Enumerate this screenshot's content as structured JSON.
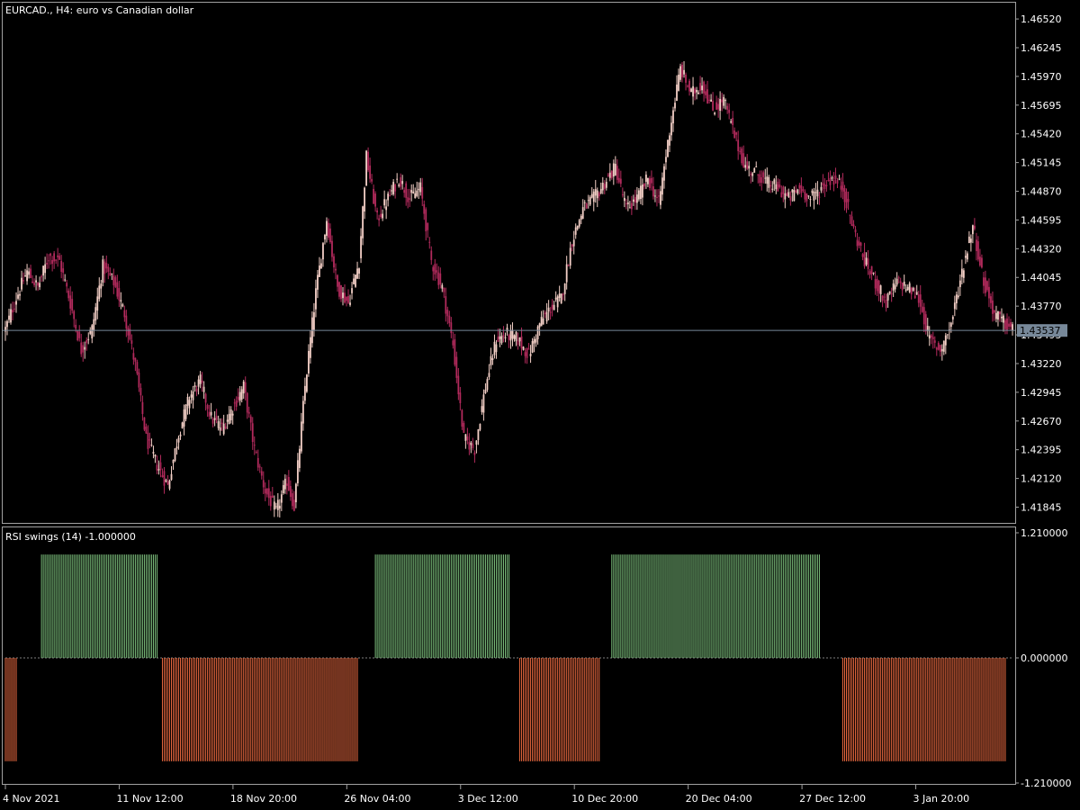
{
  "colors": {
    "background": "#000000",
    "frame": "#a0a0a0",
    "text": "#ffffff",
    "bull_candle": "#f3cfc6",
    "bear_candle": "#b22a5c",
    "current_price_line": "#778899",
    "price_tag_bg": "#778899",
    "rsi_up": "#7ec27e",
    "rsi_down": "#e8683f",
    "zero_line": "#808080"
  },
  "main_chart": {
    "title": "EURCAD., H4:  euro vs Canadian dollar",
    "current_price": "1.43537",
    "current_price_value": 1.43537,
    "y_min": 1.4172,
    "y_max": 1.4665,
    "y_ticks": [
      "1.46520",
      "1.46245",
      "1.45970",
      "1.45695",
      "1.45420",
      "1.45145",
      "1.44870",
      "1.44595",
      "1.44320",
      "1.44045",
      "1.43770",
      "1.43495",
      "1.43220",
      "1.42945",
      "1.42670",
      "1.42395",
      "1.42120",
      "1.41845"
    ]
  },
  "indicator": {
    "title": "RSI swings (14) -1.000000",
    "y_ticks": [
      "1.210000",
      "0.000000",
      "-1.210000"
    ],
    "y_min": -1.21,
    "y_max": 1.21
  },
  "x_axis": {
    "labels": [
      "4 Nov 2021",
      "11 Nov 12:00",
      "18 Nov 20:00",
      "26 Nov 04:00",
      "3 Dec 12:00",
      "10 Dec 20:00",
      "20 Dec 04:00",
      "27 Dec 12:00",
      "3 Jan 20:00"
    ]
  },
  "chart_data": {
    "type": "candlestick",
    "title": "EURCAD., H4:  euro vs Canadian dollar",
    "timeframe": "H4",
    "close_path": [
      {
        "i": 0,
        "close": 1.4355
      },
      {
        "i": 6,
        "close": 1.4385
      },
      {
        "i": 12,
        "close": 1.441
      },
      {
        "i": 18,
        "close": 1.4395
      },
      {
        "i": 24,
        "close": 1.4425
      },
      {
        "i": 30,
        "close": 1.442
      },
      {
        "i": 36,
        "close": 1.438
      },
      {
        "i": 42,
        "close": 1.4335
      },
      {
        "i": 48,
        "close": 1.4355
      },
      {
        "i": 54,
        "close": 1.4415
      },
      {
        "i": 60,
        "close": 1.44
      },
      {
        "i": 66,
        "close": 1.437
      },
      {
        "i": 72,
        "close": 1.432
      },
      {
        "i": 78,
        "close": 1.425
      },
      {
        "i": 84,
        "close": 1.4225
      },
      {
        "i": 90,
        "close": 1.4205
      },
      {
        "i": 96,
        "close": 1.4255
      },
      {
        "i": 102,
        "close": 1.429
      },
      {
        "i": 108,
        "close": 1.4305
      },
      {
        "i": 114,
        "close": 1.427
      },
      {
        "i": 120,
        "close": 1.426
      },
      {
        "i": 126,
        "close": 1.428
      },
      {
        "i": 132,
        "close": 1.43
      },
      {
        "i": 138,
        "close": 1.424
      },
      {
        "i": 144,
        "close": 1.42
      },
      {
        "i": 150,
        "close": 1.418
      },
      {
        "i": 156,
        "close": 1.421
      },
      {
        "i": 160,
        "close": 1.4185
      },
      {
        "i": 166,
        "close": 1.43
      },
      {
        "i": 172,
        "close": 1.439
      },
      {
        "i": 178,
        "close": 1.446
      },
      {
        "i": 184,
        "close": 1.4395
      },
      {
        "i": 190,
        "close": 1.438
      },
      {
        "i": 196,
        "close": 1.442
      },
      {
        "i": 200,
        "close": 1.452
      },
      {
        "i": 206,
        "close": 1.446
      },
      {
        "i": 212,
        "close": 1.448
      },
      {
        "i": 218,
        "close": 1.45
      },
      {
        "i": 224,
        "close": 1.448
      },
      {
        "i": 230,
        "close": 1.449
      },
      {
        "i": 236,
        "close": 1.442
      },
      {
        "i": 242,
        "close": 1.4395
      },
      {
        "i": 248,
        "close": 1.434
      },
      {
        "i": 254,
        "close": 1.425
      },
      {
        "i": 260,
        "close": 1.424
      },
      {
        "i": 266,
        "close": 1.43
      },
      {
        "i": 272,
        "close": 1.4345
      },
      {
        "i": 278,
        "close": 1.435
      },
      {
        "i": 284,
        "close": 1.4345
      },
      {
        "i": 290,
        "close": 1.433
      },
      {
        "i": 296,
        "close": 1.436
      },
      {
        "i": 302,
        "close": 1.4375
      },
      {
        "i": 308,
        "close": 1.4385
      },
      {
        "i": 314,
        "close": 1.444
      },
      {
        "i": 320,
        "close": 1.447
      },
      {
        "i": 326,
        "close": 1.448
      },
      {
        "i": 332,
        "close": 1.4495
      },
      {
        "i": 338,
        "close": 1.451
      },
      {
        "i": 344,
        "close": 1.447
      },
      {
        "i": 350,
        "close": 1.448
      },
      {
        "i": 356,
        "close": 1.45
      },
      {
        "i": 362,
        "close": 1.4475
      },
      {
        "i": 368,
        "close": 1.4545
      },
      {
        "i": 374,
        "close": 1.4605
      },
      {
        "i": 380,
        "close": 1.458
      },
      {
        "i": 386,
        "close": 1.459
      },
      {
        "i": 392,
        "close": 1.4565
      },
      {
        "i": 398,
        "close": 1.4575
      },
      {
        "i": 404,
        "close": 1.454
      },
      {
        "i": 410,
        "close": 1.451
      },
      {
        "i": 416,
        "close": 1.4505
      },
      {
        "i": 422,
        "close": 1.4495
      },
      {
        "i": 428,
        "close": 1.449
      },
      {
        "i": 434,
        "close": 1.448
      },
      {
        "i": 440,
        "close": 1.449
      },
      {
        "i": 446,
        "close": 1.448
      },
      {
        "i": 452,
        "close": 1.449
      },
      {
        "i": 458,
        "close": 1.45
      },
      {
        "i": 464,
        "close": 1.449
      },
      {
        "i": 470,
        "close": 1.445
      },
      {
        "i": 476,
        "close": 1.442
      },
      {
        "i": 482,
        "close": 1.44
      },
      {
        "i": 488,
        "close": 1.438
      },
      {
        "i": 494,
        "close": 1.44
      },
      {
        "i": 500,
        "close": 1.4395
      },
      {
        "i": 506,
        "close": 1.4385
      },
      {
        "i": 512,
        "close": 1.4345
      },
      {
        "i": 518,
        "close": 1.4335
      },
      {
        "i": 524,
        "close": 1.436
      },
      {
        "i": 530,
        "close": 1.441
      },
      {
        "i": 536,
        "close": 1.4455
      },
      {
        "i": 542,
        "close": 1.44
      },
      {
        "i": 548,
        "close": 1.437
      },
      {
        "i": 554,
        "close": 1.436
      },
      {
        "i": 558,
        "close": 1.4354
      }
    ],
    "bar_count": 559,
    "rsi_swings": [
      {
        "start_i": 0,
        "end_i": 6,
        "value": -1
      },
      {
        "start_i": 20,
        "end_i": 84,
        "value": 1
      },
      {
        "start_i": 87,
        "end_i": 195,
        "value": -1
      },
      {
        "start_i": 205,
        "end_i": 279,
        "value": 1
      },
      {
        "start_i": 285,
        "end_i": 329,
        "value": -1
      },
      {
        "start_i": 336,
        "end_i": 451,
        "value": 1
      },
      {
        "start_i": 464,
        "end_i": 554,
        "value": -1
      }
    ],
    "x_labels": [
      "4 Nov 2021",
      "11 Nov 12:00",
      "18 Nov 20:00",
      "26 Nov 04:00",
      "3 Dec 12:00",
      "10 Dec 20:00",
      "20 Dec 04:00",
      "27 Dec 12:00",
      "3 Jan 20:00"
    ],
    "ylim_price": [
      1.4172,
      1.4665
    ],
    "ylim_indicator": [
      -1.21,
      1.21
    ],
    "grid": false
  }
}
